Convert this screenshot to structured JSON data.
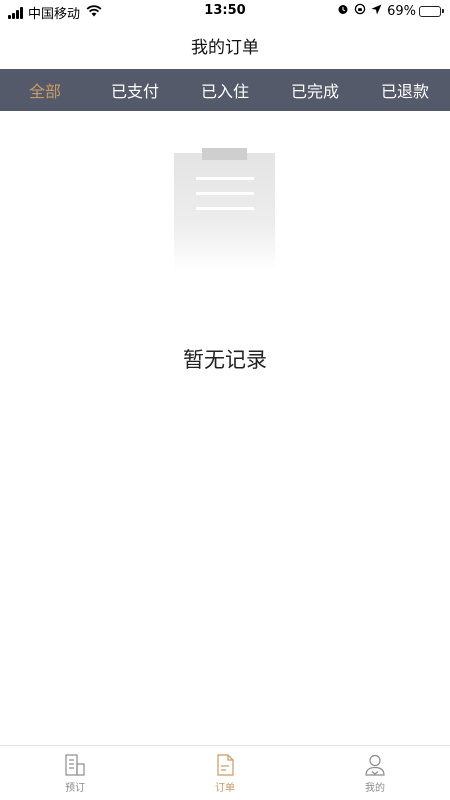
{
  "status_bar": {
    "carrier": "中国移动",
    "time": "13:50",
    "battery": "69%",
    "battery_level": 0.69,
    "icons": [
      "signal-icon",
      "wifi-icon",
      "alarm-icon",
      "rotation-lock-icon",
      "location-icon",
      "battery-icon"
    ]
  },
  "header": {
    "title": "我的订单"
  },
  "tabs": [
    {
      "label": "全部",
      "active": true
    },
    {
      "label": "已支付",
      "active": false
    },
    {
      "label": "已入住",
      "active": false
    },
    {
      "label": "已完成",
      "active": false
    },
    {
      "label": "已退款",
      "active": false
    }
  ],
  "empty_state": {
    "icon": "clipboard-icon",
    "message": "暂无记录"
  },
  "bottom_nav": [
    {
      "label": "预订",
      "icon": "building-icon",
      "active": false
    },
    {
      "label": "订单",
      "icon": "document-icon",
      "active": true
    },
    {
      "label": "我的",
      "icon": "user-icon",
      "active": false
    }
  ],
  "colors": {
    "tab_bar_bg": "#555a6a",
    "accent": "#c79a67",
    "inactive": "#8c8c8c"
  }
}
